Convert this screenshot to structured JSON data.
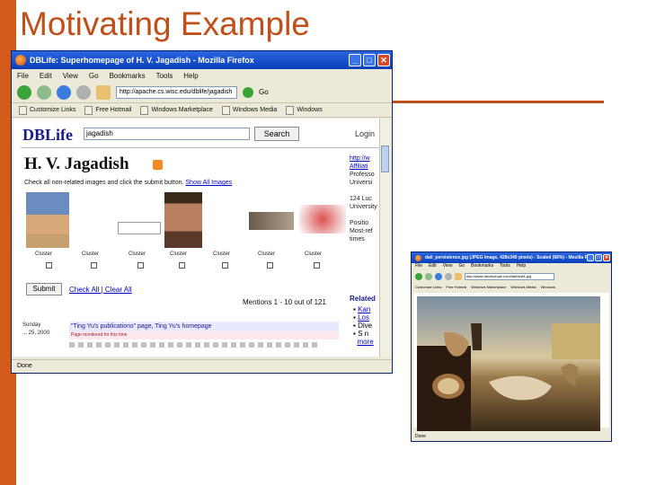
{
  "slide": {
    "title": "Motivating Example",
    "accent_color": "#c0501a"
  },
  "main_window": {
    "title": "DBLife: Superhomepage of H. V. Jagadish - Mozilla Firefox",
    "menu": [
      "File",
      "Edit",
      "View",
      "Go",
      "Bookmarks",
      "Tools",
      "Help"
    ],
    "url": "http://apache.cs.wisc.edu/dblife/jagadish",
    "go_label": "Go",
    "bookmarks": [
      "Customize Links",
      "Free Hotmail",
      "Windows Marketplace",
      "Windows Media",
      "Windows"
    ],
    "status": "Done",
    "page": {
      "logo": "DBLife",
      "search_value": "jagadish",
      "search_button": "Search",
      "login": "Login",
      "person_name": "H. V. Jagadish",
      "instruction": "Check all non-related images and click the submit button.",
      "show_all_images": "Show All Images",
      "image_labels": [
        "Cluster",
        "Cluster",
        "Cluster",
        "Cluster",
        "Cluster",
        "Cluster",
        "Cluster"
      ],
      "submit": "Submit",
      "check_all": "Check All",
      "clear_all": "Clear All",
      "mentions": "Mentions 1 - 10 out of 121",
      "result_date_line1": "Sunday",
      "result_date_line2": "... 25, 2000",
      "result_title": "\"Ting Yu's publications\" page, Ting Yu's homepage",
      "result_note": "Page monitored for this time",
      "sidebar_lines": [
        "http://w",
        "Affiliati",
        "Professo",
        "Universi",
        "",
        "124 Luc",
        "University",
        "",
        "Positio",
        "Most-ref",
        "times"
      ],
      "related_heading": "Related",
      "related_items": [
        "Kan",
        "Los",
        "Dive",
        "S n",
        "more"
      ]
    }
  },
  "second_window": {
    "title": "dali_persistence.jpg (JPEG Image, 428x340 pixels) - Scaled (66%) - Mozilla Firefox",
    "menu": [
      "File",
      "Edit",
      "View",
      "Go",
      "Bookmarks",
      "Tools",
      "Help"
    ],
    "url": "http://www.artofeurope.com/dali/dali4.jpg",
    "bookmarks": [
      "Customize Links",
      "Free Hotmail",
      "Windows Marketplace",
      "Windows Media",
      "Windows"
    ],
    "status": "Done"
  }
}
